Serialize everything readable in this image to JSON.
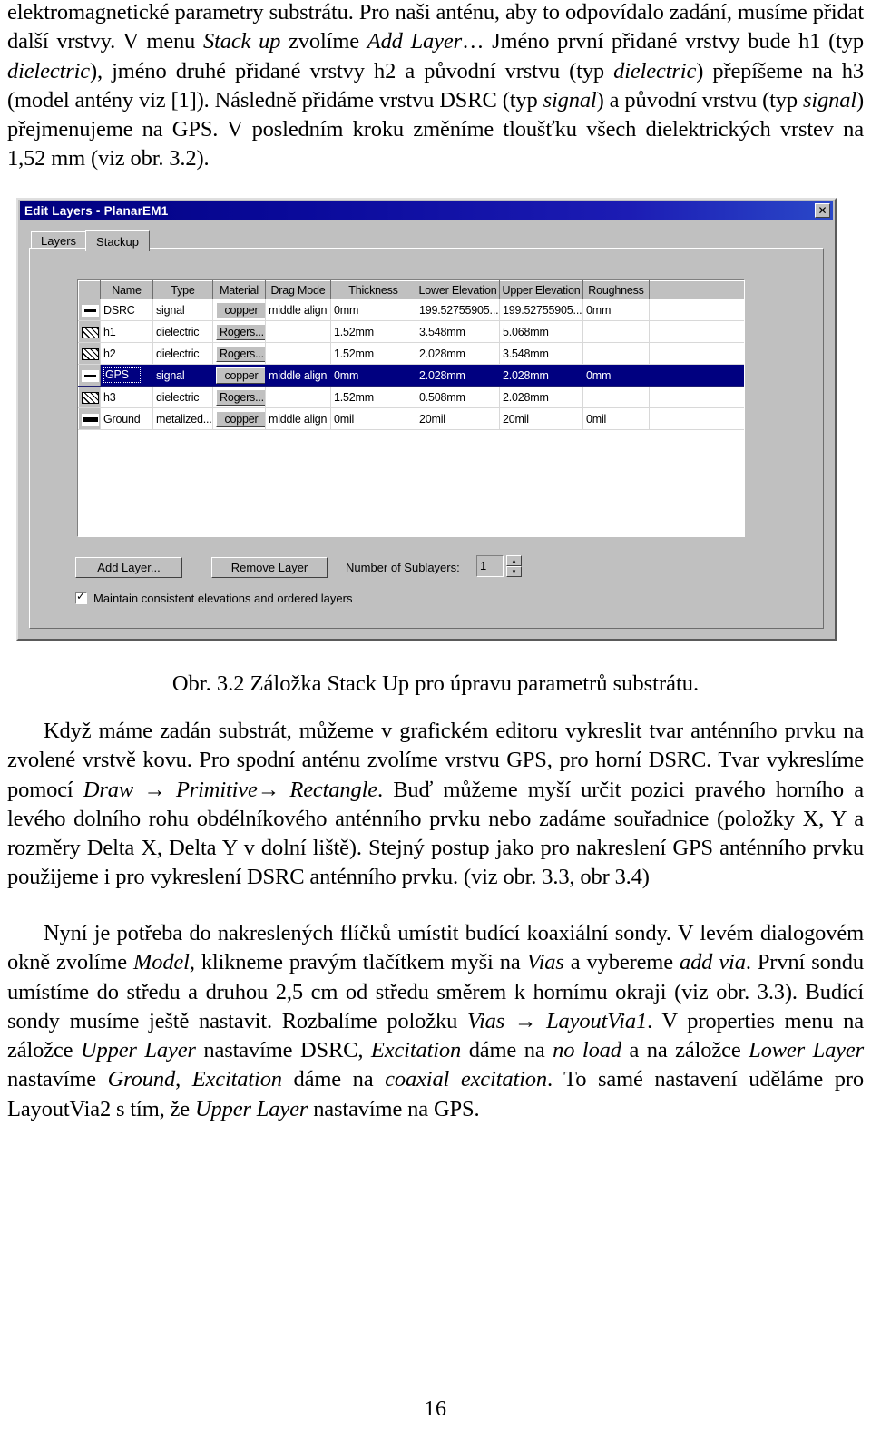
{
  "document": {
    "page_number": "16",
    "paragraph_1": "elektromagnetické parametry substrátu. Pro naši anténu, aby to odpovídalo zadání, musíme přidat další vrstvy. V menu ",
    "p1_italic_1": "Stack up",
    "p1_cont_1": " zvolíme ",
    "p1_italic_2": "Add Layer",
    "p1_cont_2": "… Jméno první přidané vrstvy bude h1 (typ ",
    "p1_italic_3": "dielectric",
    "p1_cont_3": "), jméno druhé přidané vrstvy h2 a původní vrstvu (typ ",
    "p1_italic_4": "dielectric",
    "p1_cont_4": ") přepíšeme na h3 (model antény viz [1]). Následně přidáme vrstvu DSRC (typ ",
    "p1_italic_5": "signal",
    "p1_cont_5": ") a původní vrstvu (typ ",
    "p1_italic_6": "signal",
    "p1_cont_6": ") přejmenujeme na GPS. V posledním kroku změníme tloušťku všech dielektrických vrstev na 1,52 mm (viz obr. 3.2).",
    "figure_caption": "Obr. 3.2 Záložka Stack Up pro úpravu parametrů substrátu.",
    "paragraph_2": "Když máme zadán substrát, můžeme v grafickém editoru vykreslit tvar anténního prvku na zvolené vrstvě kovu. Pro spodní anténu zvolíme vrstvu GPS, pro horní DSRC. Tvar vykreslíme pomocí ",
    "p2_italic_1": "Draw",
    "p2_arrow_1": " → ",
    "p2_italic_2": "Primitive",
    "p2_arrow_2": "→ ",
    "p2_italic_3": "Rectangle",
    "p2_cont_1": ". Buď můžeme myší určit pozici pravého horního a levého dolního rohu obdélníkového anténního prvku nebo zadáme souřadnice (položky X, Y a rozměry Delta X, Delta Y v dolní liště). Stejný postup jako pro nakreslení GPS anténního prvku použijeme i pro vykreslení DSRC anténního prvku. (viz obr. 3.3, obr 3.4)",
    "paragraph_3": "Nyní je potřeba do nakreslených flíčků umístit budící koaxiální sondy. V levém dialogovém okně zvolíme ",
    "p3_italic_1": "Model",
    "p3_cont_1": ", klikneme pravým tlačítkem myši na ",
    "p3_italic_2": "Vias",
    "p3_cont_2": " a vybereme ",
    "p3_italic_3": "add via",
    "p3_cont_3": ". První sondu umístíme do středu a druhou 2,5 cm od středu směrem k hornímu okraji (viz obr. 3.3). Budící sondy musíme ještě nastavit. Rozbalíme položku ",
    "p3_italic_4": "Vias",
    "p3_arrow_1": " → ",
    "p3_italic_5": "LayoutVia1",
    "p3_cont_4": ". V properties menu na záložce ",
    "p3_italic_6": "Upper Layer",
    "p3_cont_5": " nastavíme DSRC, ",
    "p3_italic_7": "Excitation",
    "p3_cont_6": " dáme na ",
    "p3_italic_8": "no load",
    "p3_cont_7": " a na záložce ",
    "p3_italic_9": "Lower Layer",
    "p3_cont_8": " nastavíme ",
    "p3_italic_10": "Ground",
    "p3_cont_9": ", ",
    "p3_italic_11": "Excitation",
    "p3_cont_10": " dáme na ",
    "p3_italic_12": "coaxial excitation",
    "p3_cont_11": ". To samé nastavení uděláme pro LayoutVia2 s tím, že ",
    "p3_italic_13": "Upper Layer",
    "p3_cont_12": " nastavíme na GPS."
  },
  "dialog": {
    "title": "Edit Layers - PlanarEM1",
    "close_label": "✕",
    "tabs": [
      {
        "label": "Layers",
        "active": false
      },
      {
        "label": "Stackup",
        "active": true
      }
    ],
    "grid": {
      "columns": [
        "",
        "Name",
        "Type",
        "Material",
        "Drag Mode",
        "Thickness",
        "Lower Elevation",
        "Upper Elevation",
        "Roughness",
        ""
      ],
      "rows": [
        {
          "icon": "signal-layer-icon",
          "name": "DSRC",
          "type": "signal",
          "material": "copper",
          "material_is_button": true,
          "drag_mode": "middle align",
          "thickness": "0mm",
          "lower_elevation": "199.52755905...",
          "upper_elevation": "199.52755905...",
          "roughness": "0mm",
          "selected": false
        },
        {
          "icon": "dielectric-layer-icon",
          "name": "h1",
          "type": "dielectric",
          "material": "Rogers...",
          "material_is_button": true,
          "drag_mode": "",
          "thickness": "1.52mm",
          "lower_elevation": "3.548mm",
          "upper_elevation": "5.068mm",
          "roughness": "",
          "selected": false
        },
        {
          "icon": "dielectric-layer-icon",
          "name": "h2",
          "type": "dielectric",
          "material": "Rogers...",
          "material_is_button": true,
          "drag_mode": "",
          "thickness": "1.52mm",
          "lower_elevation": "2.028mm",
          "upper_elevation": "3.548mm",
          "roughness": "",
          "selected": false
        },
        {
          "icon": "signal-layer-icon",
          "name": "GPS",
          "type": "signal",
          "material": "copper",
          "material_is_button": true,
          "drag_mode": "middle align",
          "thickness": "0mm",
          "lower_elevation": "2.028mm",
          "upper_elevation": "2.028mm",
          "roughness": "0mm",
          "selected": true
        },
        {
          "icon": "dielectric-layer-icon",
          "name": "h3",
          "type": "dielectric",
          "material": "Rogers...",
          "material_is_button": true,
          "drag_mode": "",
          "thickness": "1.52mm",
          "lower_elevation": "0.508mm",
          "upper_elevation": "2.028mm",
          "roughness": "",
          "selected": false
        },
        {
          "icon": "ground-layer-icon",
          "name": "Ground",
          "type": "metalized...",
          "material": "copper",
          "material_is_button": true,
          "drag_mode": "middle align",
          "thickness": "0mil",
          "lower_elevation": "20mil",
          "upper_elevation": "20mil",
          "roughness": "0mil",
          "selected": false
        }
      ]
    },
    "controls": {
      "add_layer_label": "Add Layer...",
      "remove_layer_label": "Remove Layer",
      "sublayers_label": "Number of Sublayers:",
      "sublayers_value": "1",
      "spin_up": "▴",
      "spin_down": "▾",
      "maintain_checkbox_label": "Maintain consistent elevations and ordered layers",
      "maintain_checked": true
    },
    "colors": {
      "titlebar_start": "#00007e",
      "titlebar_end": "#2a48c8",
      "selection": "#000080",
      "face": "#c0c0c0"
    }
  }
}
